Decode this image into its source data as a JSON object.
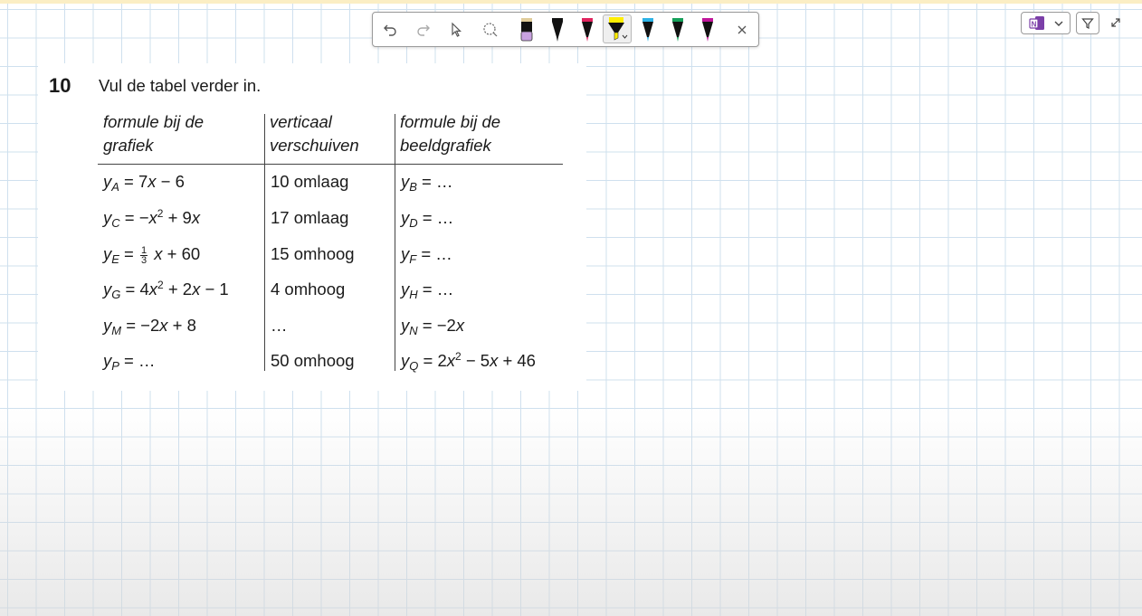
{
  "toolbar": {
    "tools": [
      "undo-icon",
      "redo-icon",
      "select-icon",
      "lasso-icon"
    ],
    "pens": [
      {
        "name": "pen-lavender",
        "color": "#c8a2e0"
      },
      {
        "name": "pen-black",
        "color": "#111111"
      },
      {
        "name": "pen-red",
        "color": "#e0245e"
      },
      {
        "name": "highlighter-yellow",
        "color": "#ffee00",
        "selected": true
      },
      {
        "name": "pen-cyan",
        "color": "#2eb3e6"
      },
      {
        "name": "pen-green",
        "color": "#16a05a"
      },
      {
        "name": "pen-magenta",
        "color": "#c0169a"
      }
    ]
  },
  "exercise": {
    "number": "10",
    "instruction": "Vul de tabel verder in.",
    "headers": {
      "col1": "formule bij de grafiek",
      "col2": "verticaal verschuiven",
      "col3": "formule bij de beeldgrafiek"
    },
    "rows": [
      {
        "c1_var": "A",
        "c1_expr": "= 7x − 6",
        "c2": "10 omlaag",
        "c3_var": "B",
        "c3_expr": "= …"
      },
      {
        "c1_var": "C",
        "c1_expr": "= −x² + 9x",
        "c2": "17 omlaag",
        "c3_var": "D",
        "c3_expr": "= …"
      },
      {
        "c1_var": "E",
        "c1_expr": "= 1/3 x + 60",
        "c2": "15 omhoog",
        "c3_var": "F",
        "c3_expr": "= …"
      },
      {
        "c1_var": "G",
        "c1_expr": "= 4x² + 2x − 1",
        "c2": "4 omhoog",
        "c3_var": "H",
        "c3_expr": "= …"
      },
      {
        "c1_var": "M",
        "c1_expr": "= −2x + 8",
        "c2": "…",
        "c3_var": "N",
        "c3_expr": "= −2x"
      },
      {
        "c1_var": "P",
        "c1_expr": "= …",
        "c2": "50 omhoog",
        "c3_var": "Q",
        "c3_expr": "= 2x² − 5x + 46"
      }
    ]
  },
  "colors": {
    "grid": "#cfe0ee",
    "top_strip": "#fbeec4",
    "toolbar_border": "#9a9a9a"
  }
}
